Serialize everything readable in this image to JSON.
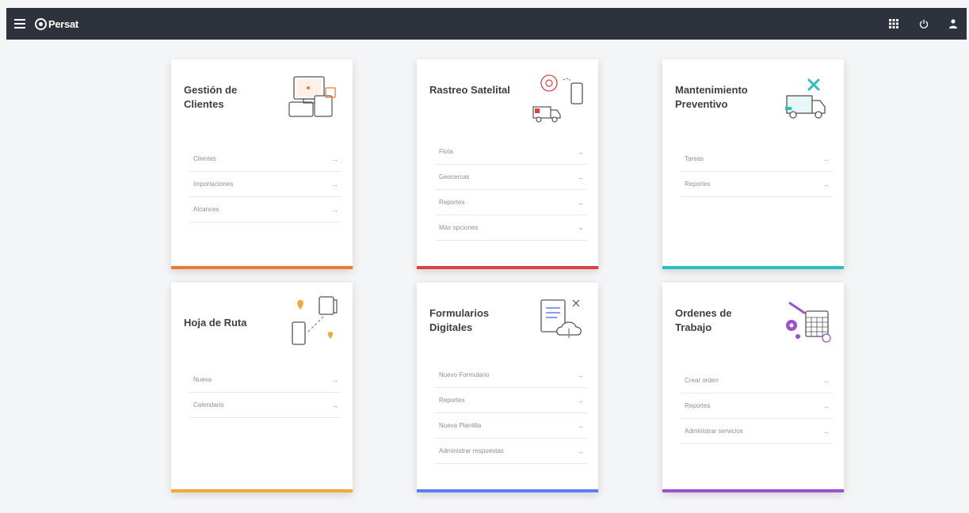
{
  "app": {
    "brand": "Persat"
  },
  "cards": [
    {
      "title": "Gestión de Clientes",
      "accent": "#ef7b30",
      "items": [
        {
          "label": "Clientes",
          "arrow": "→"
        },
        {
          "label": "Importaciones",
          "arrow": "→"
        },
        {
          "label": "Alcances",
          "arrow": "→"
        }
      ]
    },
    {
      "title": "Rastreo Satelital",
      "accent": "#e04040",
      "items": [
        {
          "label": "Flota",
          "arrow": "→"
        },
        {
          "label": "Geocercas",
          "arrow": "→"
        },
        {
          "label": "Reportes",
          "arrow": "→"
        },
        {
          "label": "Más opciones",
          "arrow": "⌄"
        }
      ]
    },
    {
      "title": "Mantenimiento Preventivo",
      "accent": "#2cbfbf",
      "items": [
        {
          "label": "Tareas",
          "arrow": "→"
        },
        {
          "label": "Reportes",
          "arrow": "→"
        }
      ]
    },
    {
      "title": "Hoja de Ruta",
      "accent": "#f3a93a",
      "items": [
        {
          "label": "Nueva",
          "arrow": "→"
        },
        {
          "label": "Calendario",
          "arrow": "→"
        }
      ]
    },
    {
      "title": "Formularios Digitales",
      "accent": "#5b7ff0",
      "items": [
        {
          "label": "Nuevo Formulario",
          "arrow": "→"
        },
        {
          "label": "Reportes",
          "arrow": "→"
        },
        {
          "label": "Nueva Plantilla",
          "arrow": "→"
        },
        {
          "label": "Administrar respuestas",
          "arrow": "→"
        }
      ]
    },
    {
      "title": "Ordenes de Trabajo",
      "accent": "#9b4fd1",
      "items": [
        {
          "label": "Crear orden",
          "arrow": "→"
        },
        {
          "label": "Reportes",
          "arrow": "→"
        },
        {
          "label": "Administrar servicios",
          "arrow": "→"
        }
      ]
    }
  ]
}
